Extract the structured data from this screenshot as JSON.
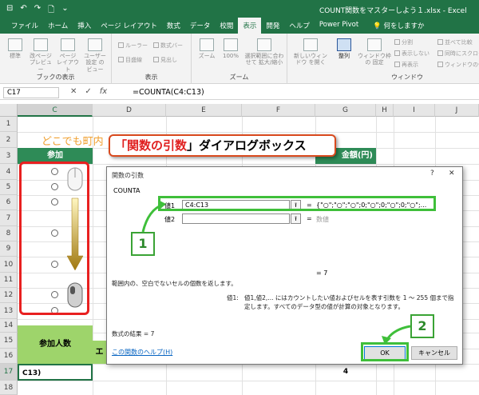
{
  "window": {
    "title": "COUNT関数をマスターしよう１.xlsx - Excel",
    "qat": [
      "⊟",
      "↶",
      "↷",
      "🗋",
      "⌄"
    ]
  },
  "tabs": [
    "ファイル",
    "ホーム",
    "挿入",
    "ページ レイアウト",
    "数式",
    "データ",
    "校閲",
    "表示",
    "開発",
    "ヘルプ",
    "Power Pivot"
  ],
  "tell_me": "何をしますか",
  "ribbon": {
    "groups": {
      "book_views": "ブックの表示",
      "show": "表示",
      "zoom": "ズーム",
      "window": "ウィンドウ"
    },
    "buttons": {
      "normal": "標準",
      "page_break": "改ページ プレビュー",
      "page_layout": "ページ レイアウト",
      "custom_views": "ユーザー設定 のビュー",
      "ruler": "ルーラー",
      "formula_bar": "数式バー",
      "gridlines": "目盛線",
      "headings": "見出し",
      "zoom": "ズーム",
      "zoom100": "100%",
      "zoom_sel": "選択範囲に合わせて 拡大/縮小",
      "new_window": "新しいウィンドウ を開く",
      "arrange": "整列",
      "freeze": "ウィンドウ枠の 固定",
      "split": "分割",
      "hide": "表示しない",
      "unhide": "再表示",
      "side_by_side": "並べて比較",
      "sync_scroll": "同時にスクロール",
      "reset_pos": "ウィンドウの位置を"
    }
  },
  "formula_bar": {
    "name_box": "C17",
    "formula": "=COUNTA(C4:C13)",
    "cancel": "✕",
    "enter": "✓",
    "fx": "fx"
  },
  "columns": [
    "C",
    "D",
    "E",
    "F",
    "G",
    "H",
    "I",
    "J"
  ],
  "rows": [
    "1",
    "2",
    "3",
    "4",
    "5",
    "6",
    "7",
    "8",
    "9",
    "10",
    "11",
    "12",
    "13",
    "14",
    "15",
    "16",
    "17",
    "18"
  ],
  "sheet": {
    "title_partial": "どこでも町内",
    "c3": "参加",
    "g3": "金額(円)",
    "sankaninzu": "参加人数",
    "e16_partial": "エ",
    "c17": "C13)",
    "g17": "4",
    "circle": "○"
  },
  "banner": {
    "prefix": "「",
    "highlight": "関数の引数",
    "suffix": "」ダイアログボックス"
  },
  "dialog": {
    "title": "関数の引数",
    "help": "?",
    "close": "✕",
    "function": "COUNTA",
    "arg1_label": "値1",
    "arg1_value": "C4:C13",
    "arg1_result": "{\"○\";\"○\";\"○\";0;\"○\";0;\"○\";0;\"○\";...",
    "arg2_label": "値2",
    "arg2_placeholder": "数値",
    "eq": "=",
    "ref_icon": "⭱",
    "result_inline": "=  7",
    "description": "範囲内の、空白でないセルの個数を返します。",
    "arg_detail_label": "値1:",
    "arg_detail": "値1,値2,... にはカウントしたい値およびセルを表す引数を 1 〜 255 個まで指定します。すべてのデータ型の値が計算の対象となります。",
    "result_label": "数式の結果 =",
    "result_value": "7",
    "help_link": "この関数のヘルプ(H)",
    "ok": "OK",
    "cancel": "キャンセル"
  },
  "callouts": {
    "one": "1",
    "two": "2"
  },
  "colors": {
    "excel_green": "#217346",
    "header_green": "#2e8b57",
    "light_green": "#9ed46b",
    "callout_green": "#3fbf3a",
    "callout_red": "#e82020"
  }
}
